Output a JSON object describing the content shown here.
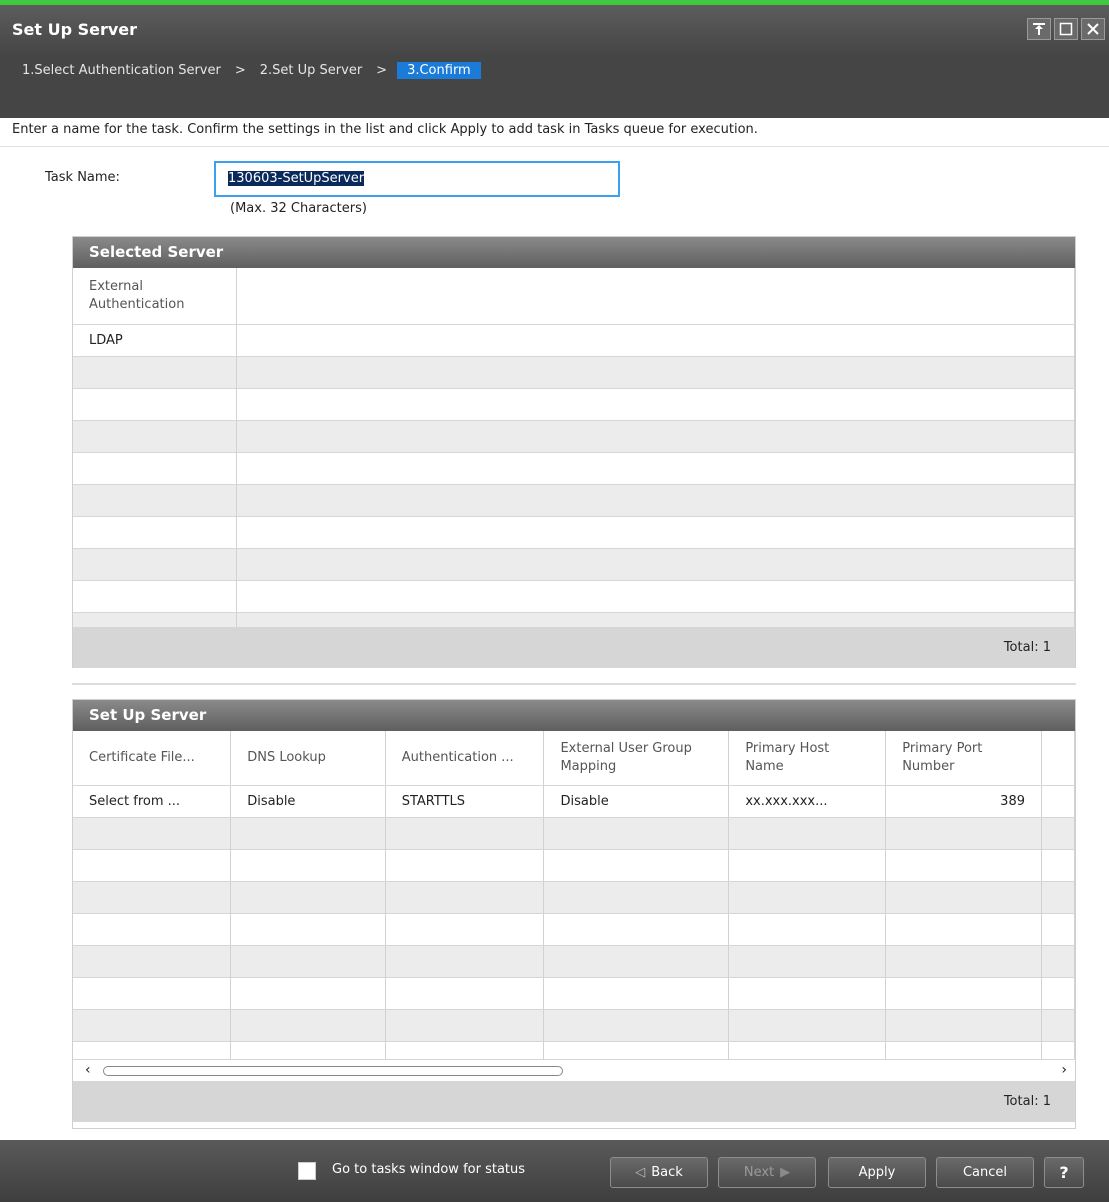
{
  "window": {
    "title": "Set Up Server",
    "controls": [
      "pin-icon",
      "maximize-icon",
      "close-icon"
    ]
  },
  "breadcrumb": {
    "steps": [
      "1.Select Authentication Server",
      "2.Set Up Server",
      "3.Confirm"
    ],
    "separator": ">",
    "active_index": 2
  },
  "instructions": "Enter a name for the task. Confirm the settings in the list and click Apply to add task in Tasks queue for execution.",
  "task_name": {
    "label": "Task Name:",
    "value": "130603-SetUpServer",
    "hint": "(Max. 32 Characters)"
  },
  "selected_server": {
    "title": "Selected Server",
    "columns": [
      "External Authentication"
    ],
    "rows": [
      [
        "LDAP"
      ]
    ],
    "total_label": "Total:",
    "total": "1"
  },
  "set_up_server": {
    "title": "Set Up Server",
    "columns": [
      "Certificate File...",
      "DNS Lookup",
      "Authentication ...",
      "External User Group Mapping",
      "Primary Host Name",
      "Primary Port Number"
    ],
    "rows": [
      [
        "Select from ...",
        "Disable",
        "STARTTLS",
        "Disable",
        "xx.xxx.xxx...",
        "389"
      ]
    ],
    "total_label": "Total:",
    "total": "1"
  },
  "footer": {
    "checkbox_label": "Go to tasks window for status",
    "checkbox_checked": false,
    "back": "Back",
    "next": "Next",
    "apply": "Apply",
    "cancel": "Cancel",
    "help": "?"
  },
  "colors": {
    "accent": "#1a7bd8",
    "top_strip": "#3ec93e",
    "titlebar": "#454545"
  }
}
